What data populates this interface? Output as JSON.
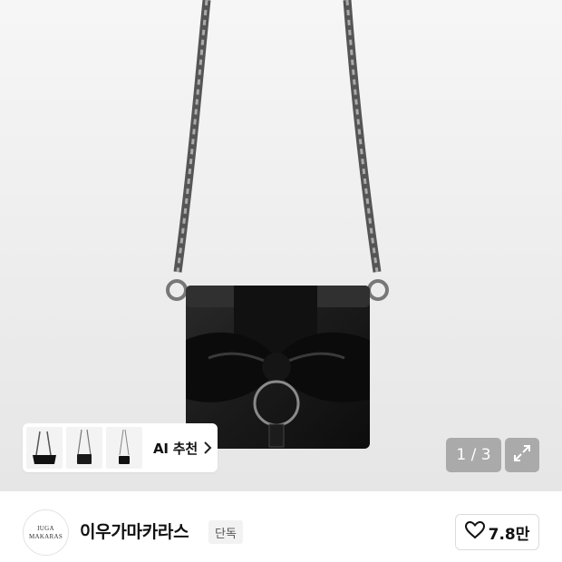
{
  "gallery": {
    "page_current": "1",
    "page_total": "3",
    "counter_text": "1 / 3",
    "expand_icon": "expand-icon"
  },
  "ai_recommend": {
    "label": "AI 추천",
    "thumbnails": [
      "bag-thumbnail-1",
      "bag-thumbnail-2",
      "bag-thumbnail-3"
    ],
    "chevron_icon": "chevron-right-icon"
  },
  "brand": {
    "logo_line1": "IUGA",
    "logo_line2": "MAKARAS",
    "name": "이우가마카라스",
    "badge": "단독"
  },
  "like": {
    "icon": "heart-icon",
    "count": "7.8만"
  },
  "colors": {
    "background": "#ececec",
    "overlay": "#787878",
    "text": "#111111"
  }
}
